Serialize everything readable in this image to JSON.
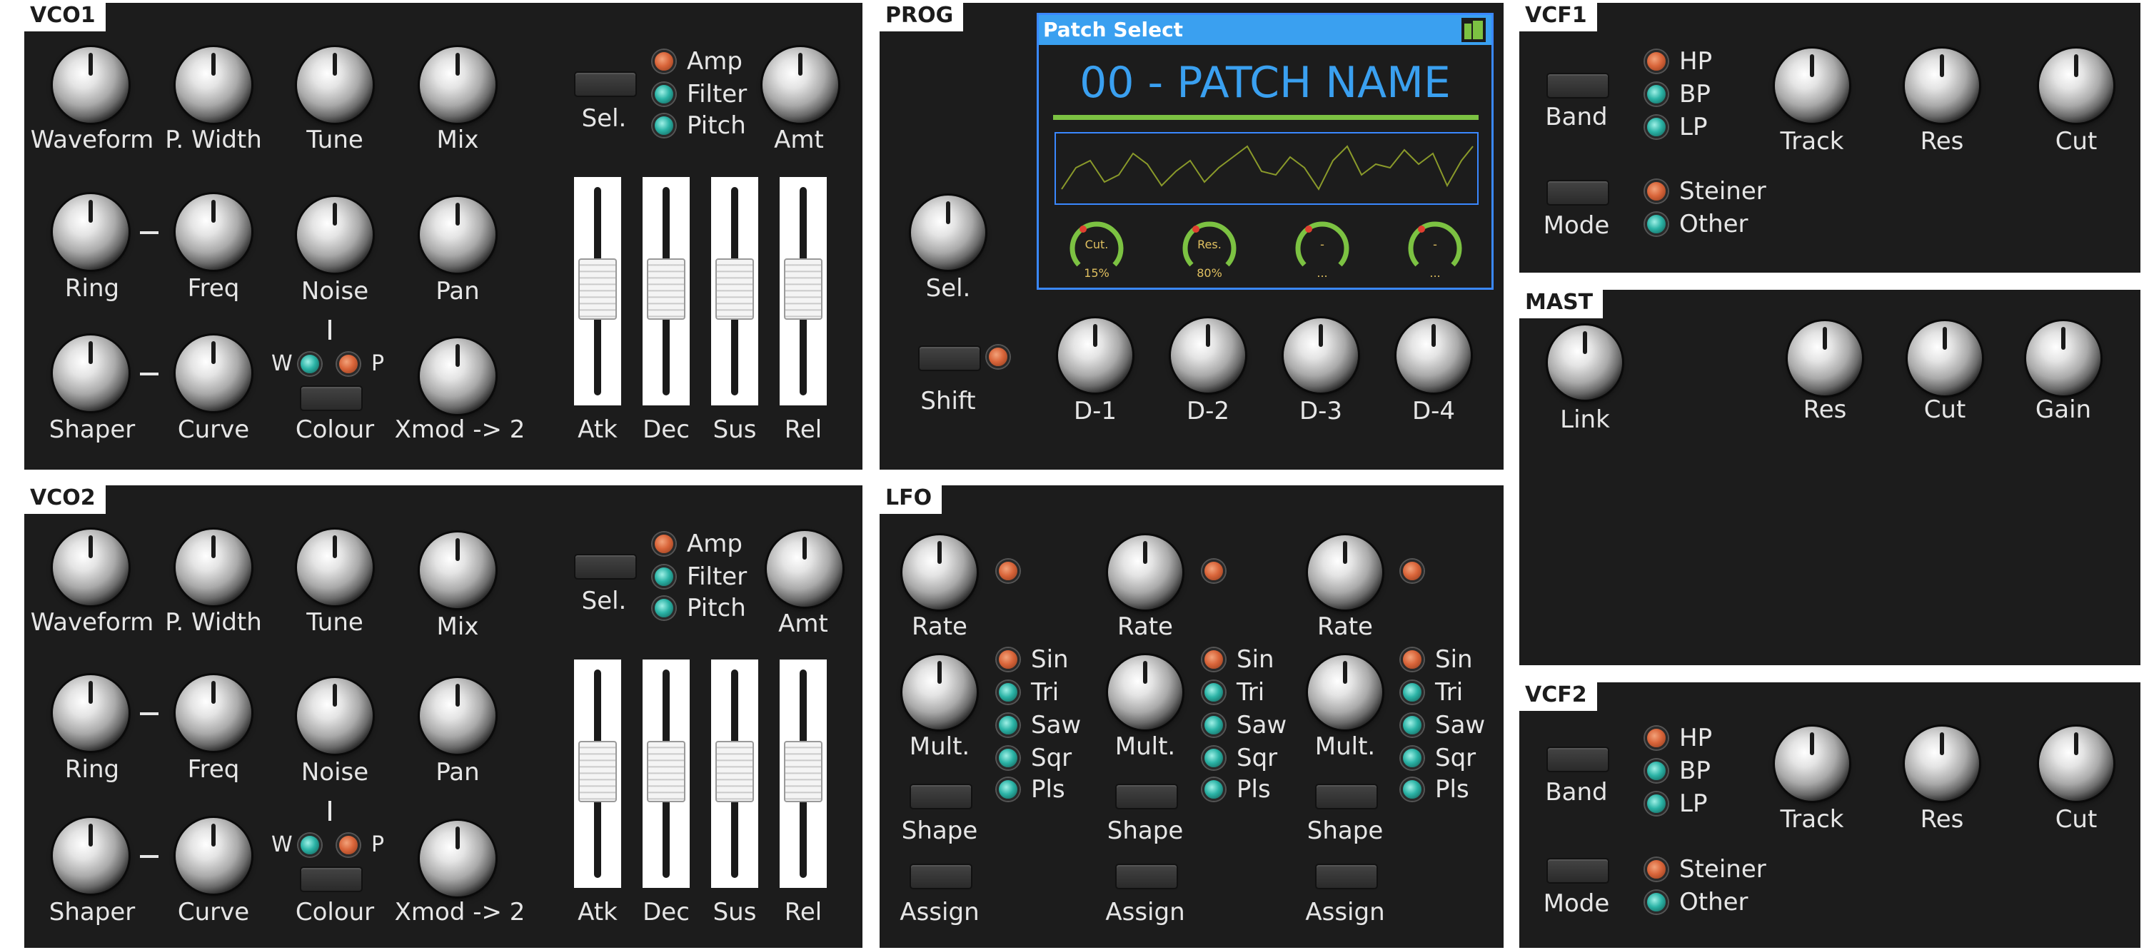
{
  "vco1": {
    "title": "VCO1",
    "knobs": [
      "Waveform",
      "P. Width",
      "Tune",
      "Mix",
      "Ring",
      "Freq",
      "Noise",
      "Pan",
      "Shaper",
      "Curve",
      "Xmod -> 2",
      "Amt"
    ],
    "sel_label": "Sel.",
    "leds": [
      "Amp",
      "Filter",
      "Pitch"
    ],
    "wp": {
      "w": "W",
      "p": "P"
    },
    "colour_label": "Colour",
    "sliders": [
      "Atk",
      "Dec",
      "Sus",
      "Rel"
    ]
  },
  "vco2": {
    "title": "VCO2",
    "knobs": [
      "Waveform",
      "P. Width",
      "Tune",
      "Mix",
      "Ring",
      "Freq",
      "Noise",
      "Pan",
      "Shaper",
      "Curve",
      "Xmod -> 2",
      "Amt"
    ],
    "sel_label": "Sel.",
    "leds": [
      "Amp",
      "Filter",
      "Pitch"
    ],
    "wp": {
      "w": "W",
      "p": "P"
    },
    "colour_label": "Colour",
    "sliders": [
      "Atk",
      "Dec",
      "Sus",
      "Rel"
    ]
  },
  "prog": {
    "title": "PROG",
    "sel_label": "Sel.",
    "shift_label": "Shift",
    "d_knobs": [
      "D-1",
      "D-2",
      "D-3",
      "D-4"
    ],
    "screen": {
      "title": "Patch Select",
      "patch_name": "00 - PATCH NAME",
      "dials": [
        {
          "name": "Cut.",
          "value": "15%"
        },
        {
          "name": "Res.",
          "value": "80%"
        },
        {
          "name": "-",
          "value": "..."
        },
        {
          "name": "-",
          "value": "..."
        }
      ]
    }
  },
  "lfo": {
    "title": "LFO",
    "rate_label": "Rate",
    "mult_label": "Mult.",
    "shape_label": "Shape",
    "assign_label": "Assign",
    "shapes": [
      "Sin",
      "Tri",
      "Saw",
      "Sqr",
      "Pls"
    ]
  },
  "vcf1": {
    "title": "VCF1",
    "band_label": "Band",
    "mode_label": "Mode",
    "band_leds": [
      "HP",
      "BP",
      "LP"
    ],
    "mode_leds": [
      "Steiner",
      "Other"
    ],
    "knobs": [
      "Track",
      "Res",
      "Cut"
    ]
  },
  "mast": {
    "title": "MAST",
    "knobs": [
      "Link",
      "Res",
      "Cut",
      "Gain"
    ]
  },
  "vcf2": {
    "title": "VCF2",
    "band_label": "Band",
    "mode_label": "Mode",
    "band_leds": [
      "HP",
      "BP",
      "LP"
    ],
    "mode_leds": [
      "Steiner",
      "Other"
    ],
    "knobs": [
      "Track",
      "Res",
      "Cut"
    ]
  },
  "colors": {
    "panel": "#1c1c1c",
    "led_orange": "#d9653a",
    "led_teal": "#2bb3a6",
    "screen_accent": "#3aa0f0",
    "patch_green": "#7cc242"
  }
}
